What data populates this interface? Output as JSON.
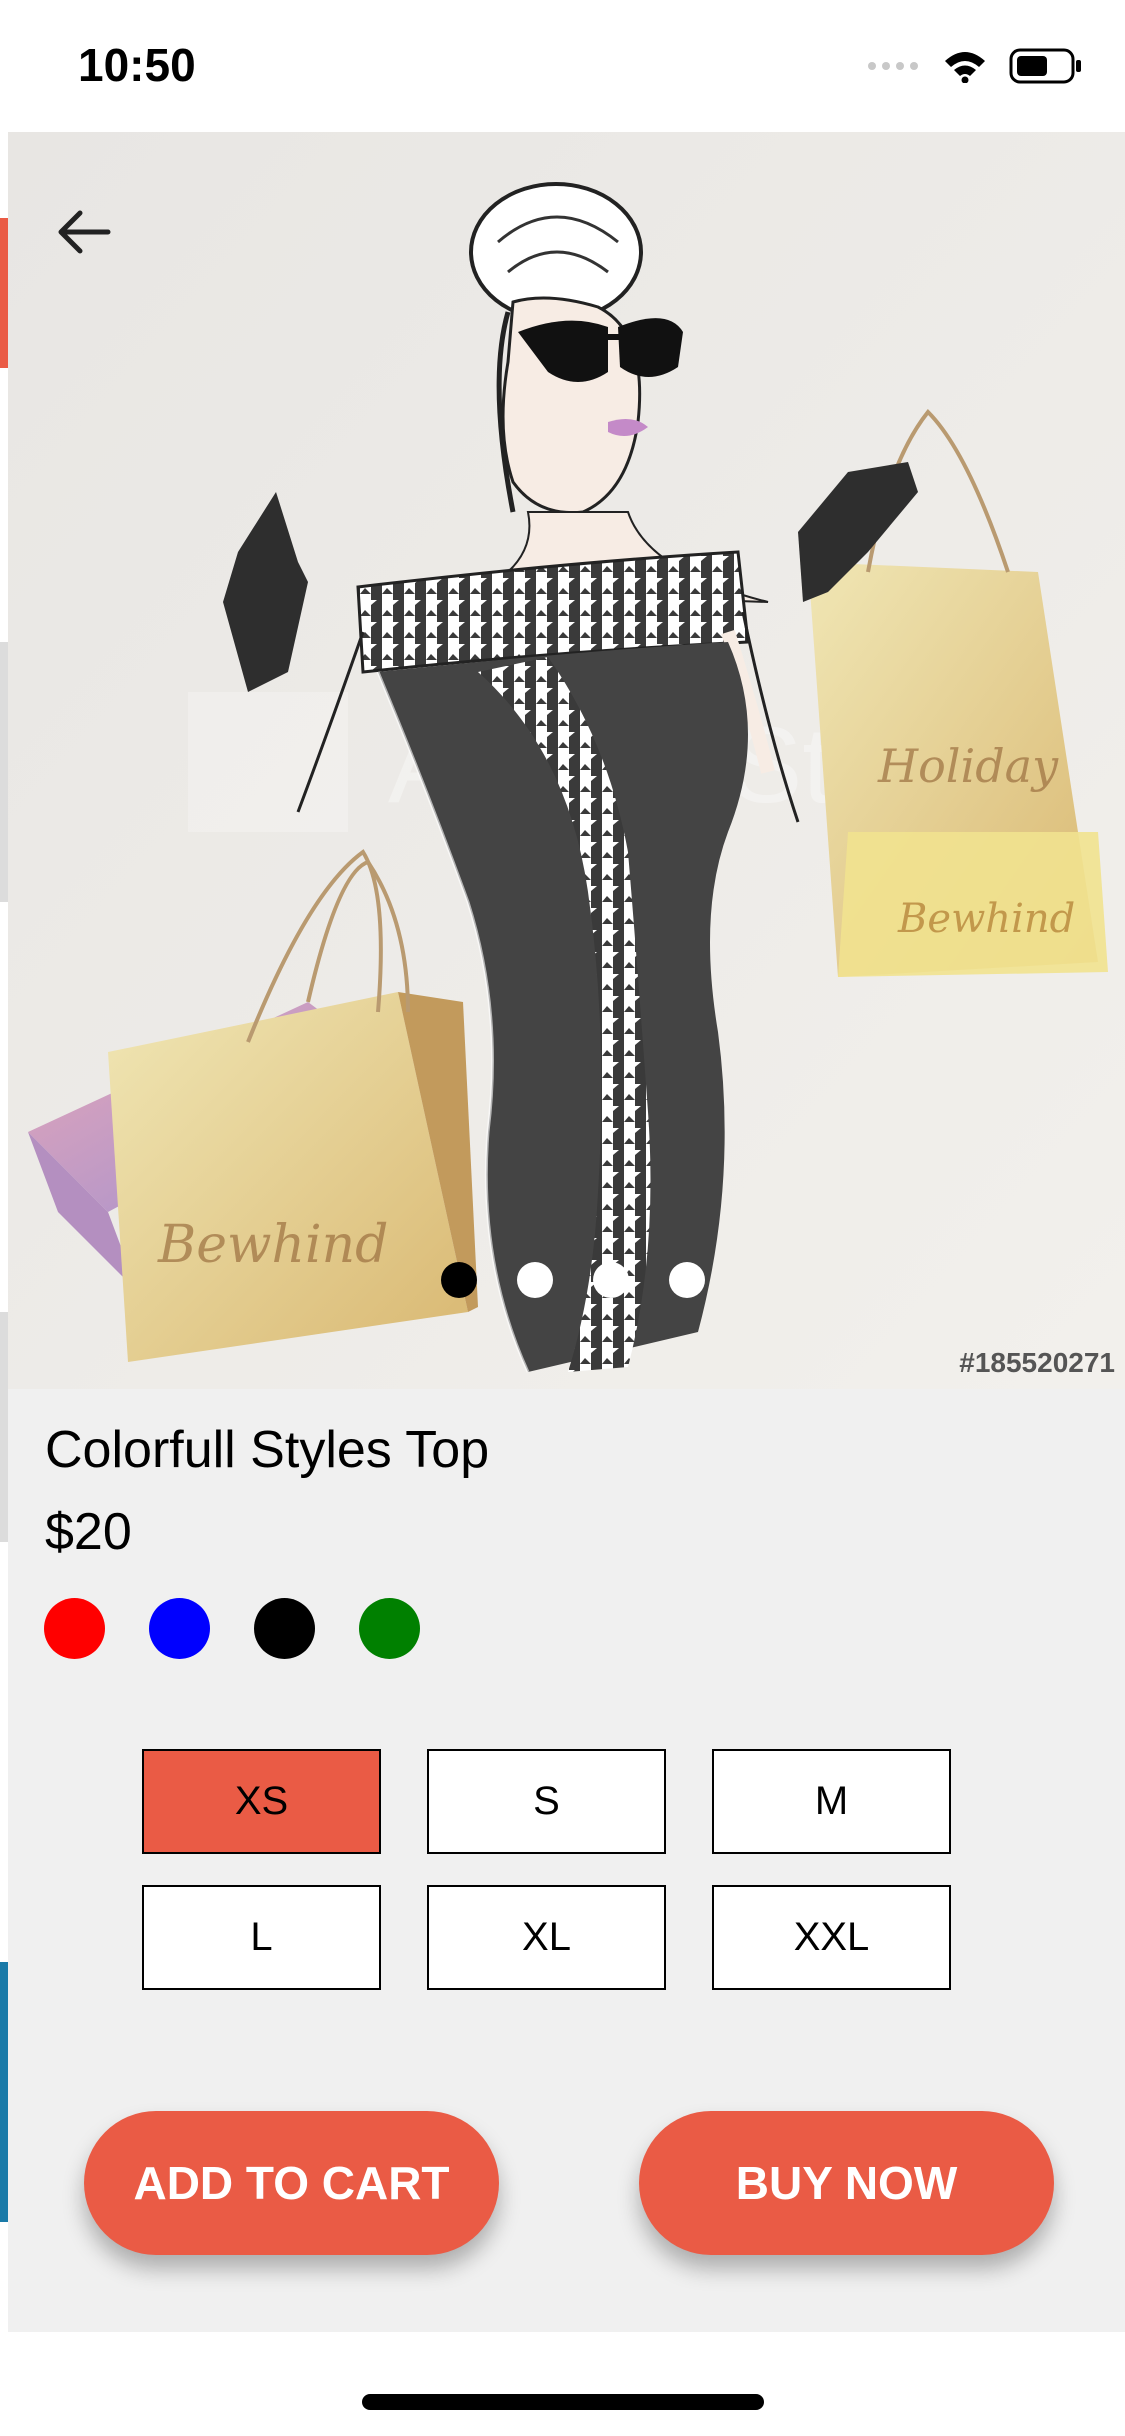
{
  "status_bar": {
    "time": "10:50"
  },
  "hero": {
    "stock_id": "#185520271",
    "slide_count": 4,
    "active_slide": 0
  },
  "product": {
    "title": "Colorfull Styles Top",
    "price": "$20",
    "colors": [
      "#ff0000",
      "#0000ff",
      "#000000",
      "#008000"
    ]
  },
  "sizes": [
    "XS",
    "S",
    "M",
    "L",
    "XL",
    "XXL"
  ],
  "selected_size": "XS",
  "actions": {
    "add_to_cart": "ADD TO CART",
    "buy_now": "BUY NOW"
  },
  "theme": {
    "accent": "#ea5b45"
  }
}
